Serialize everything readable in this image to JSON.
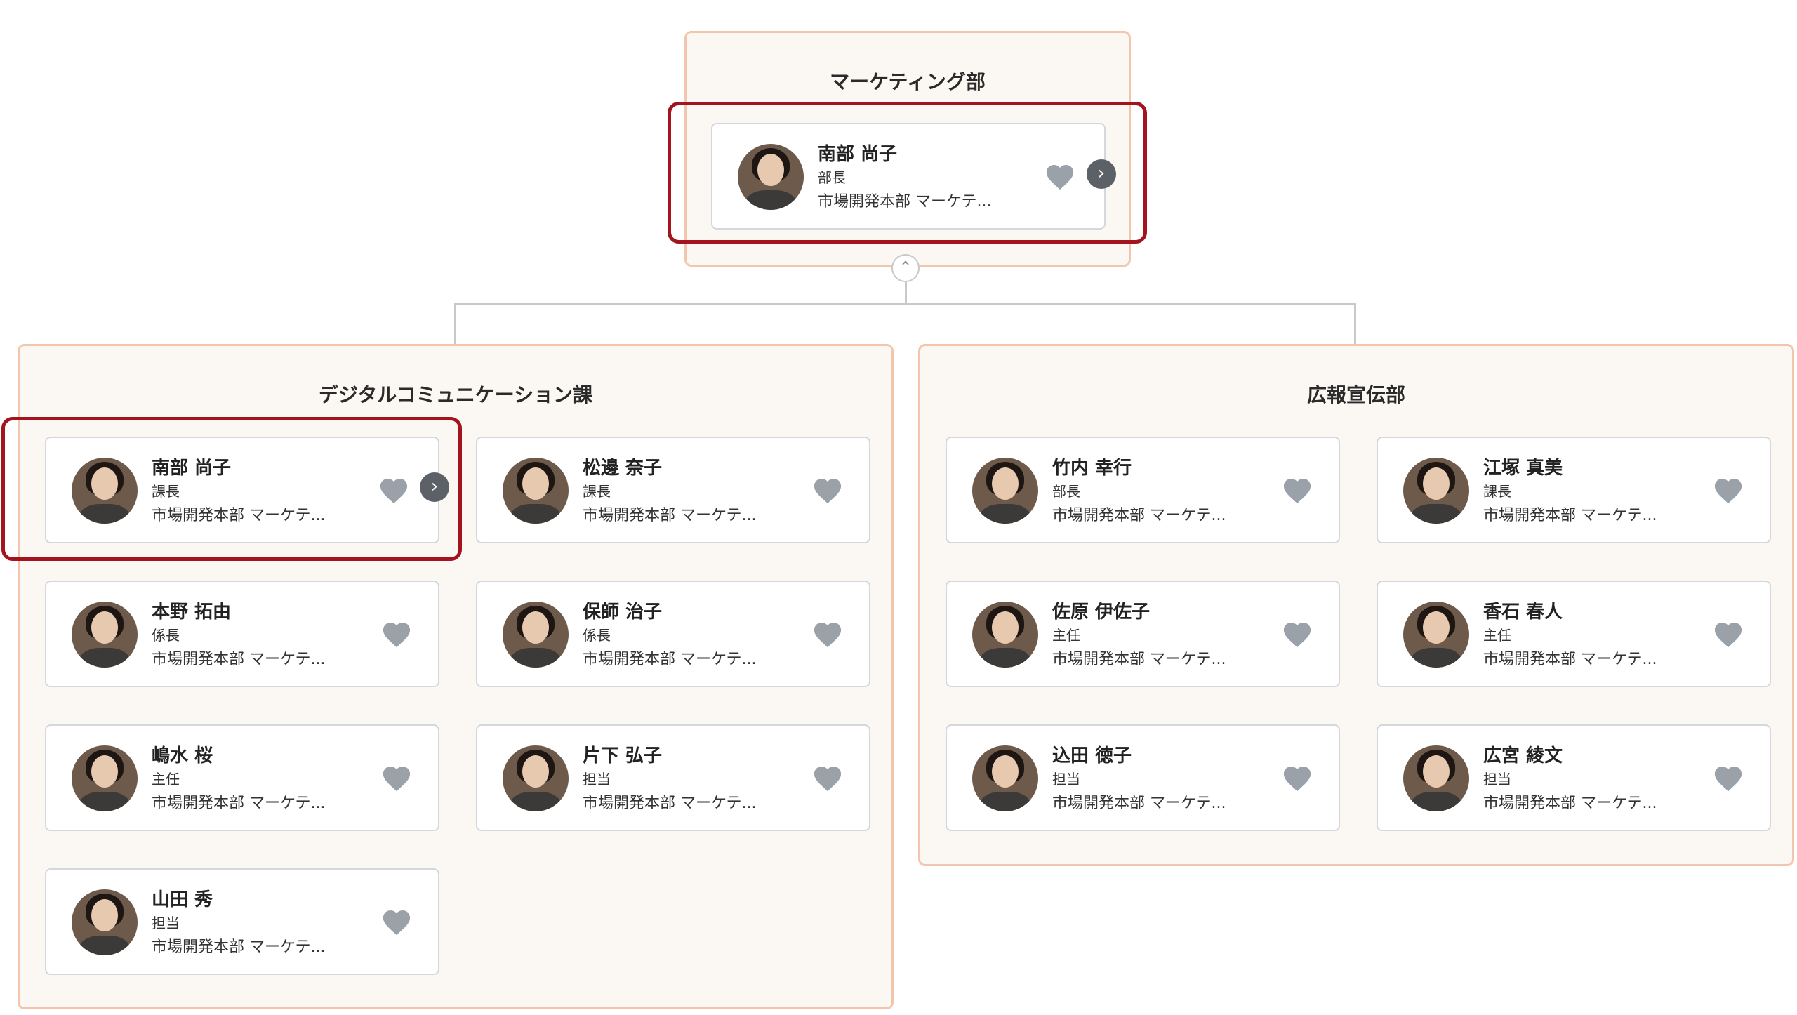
{
  "top": {
    "title": "マーケティング部",
    "card": {
      "name": "南部 尚子",
      "role": "部長",
      "dept": "市場開発本部 マーケテ..."
    }
  },
  "digital": {
    "title": "デジタルコミュニケーション課",
    "members": [
      {
        "name": "南部 尚子",
        "role": "課長",
        "dept": "市場開発本部 マーケテ..."
      },
      {
        "name": "松邊 奈子",
        "role": "課長",
        "dept": "市場開発本部 マーケテ..."
      },
      {
        "name": "本野 拓由",
        "role": "係長",
        "dept": "市場開発本部 マーケテ..."
      },
      {
        "name": "保師 治子",
        "role": "係長",
        "dept": "市場開発本部 マーケテ..."
      },
      {
        "name": "嶋水 桜",
        "role": "主任",
        "dept": "市場開発本部 マーケテ..."
      },
      {
        "name": "片下 弘子",
        "role": "担当",
        "dept": "市場開発本部 マーケテ..."
      },
      {
        "name": "山田 秀",
        "role": "担当",
        "dept": "市場開発本部 マーケテ..."
      }
    ]
  },
  "pr": {
    "title": "広報宣伝部",
    "members": [
      {
        "name": "竹内 幸行",
        "role": "部長",
        "dept": "市場開発本部 マーケテ..."
      },
      {
        "name": "江塚 真美",
        "role": "課長",
        "dept": "市場開発本部 マーケテ..."
      },
      {
        "name": "佐原 伊佐子",
        "role": "主任",
        "dept": "市場開発本部 マーケテ..."
      },
      {
        "name": "香石 春人",
        "role": "主任",
        "dept": "市場開発本部 マーケテ..."
      },
      {
        "name": "込田 徳子",
        "role": "担当",
        "dept": "市場開発本部 マーケテ..."
      },
      {
        "name": "広宮 綾文",
        "role": "担当",
        "dept": "市場開発本部 マーケテ..."
      }
    ]
  },
  "icons": {
    "favorite": "heart-icon",
    "expand": "chevron-right-icon",
    "collapse": "chevron-up-icon"
  },
  "colors": {
    "highlight": "#a3141f",
    "group_border": "#f2c6ac",
    "group_bg": "#fbf7f2",
    "heart": "#9aa1a9"
  }
}
